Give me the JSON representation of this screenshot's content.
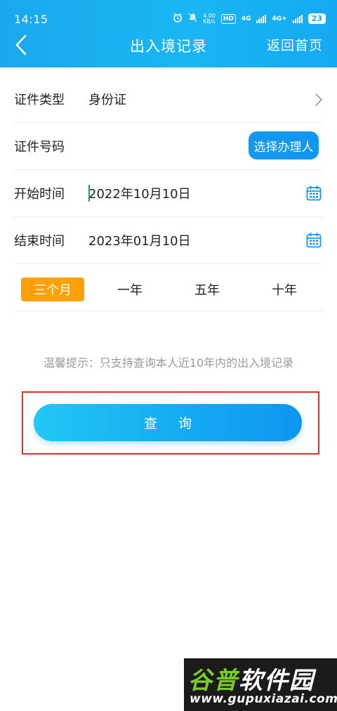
{
  "status_bar": {
    "time": "14:15",
    "net_speed_value": "4.00",
    "net_speed_unit": "KB/s",
    "hd_label": "HD",
    "network_1": "4G",
    "network_2": "4G+",
    "battery": "23"
  },
  "header": {
    "title": "出入境记录",
    "home_link": "返回首页"
  },
  "form": {
    "doc_type": {
      "label": "证件类型",
      "value": "身份证"
    },
    "doc_number": {
      "label": "证件号码",
      "value": "",
      "select_button": "选择办理人"
    },
    "start_time": {
      "label": "开始时间",
      "value": "2022年10月10日"
    },
    "end_time": {
      "label": "结束时间",
      "value": "2023年01月10日"
    }
  },
  "periods": [
    {
      "label": "三个月",
      "active": true
    },
    {
      "label": "一年",
      "active": false
    },
    {
      "label": "五年",
      "active": false
    },
    {
      "label": "十年",
      "active": false
    }
  ],
  "tip": "温馨提示：只支持查询本人近10年内的出入境记录",
  "query_button": "查 询",
  "watermark": {
    "brand_part1": "谷普",
    "brand_part2": "软件园",
    "url": "www.gupuxiazai.com"
  },
  "colors": {
    "header_blue": "#19b6f4",
    "select_button_blue": "#1296ef",
    "active_period_orange": "#ff9f0a",
    "highlight_red": "#e0302a"
  }
}
